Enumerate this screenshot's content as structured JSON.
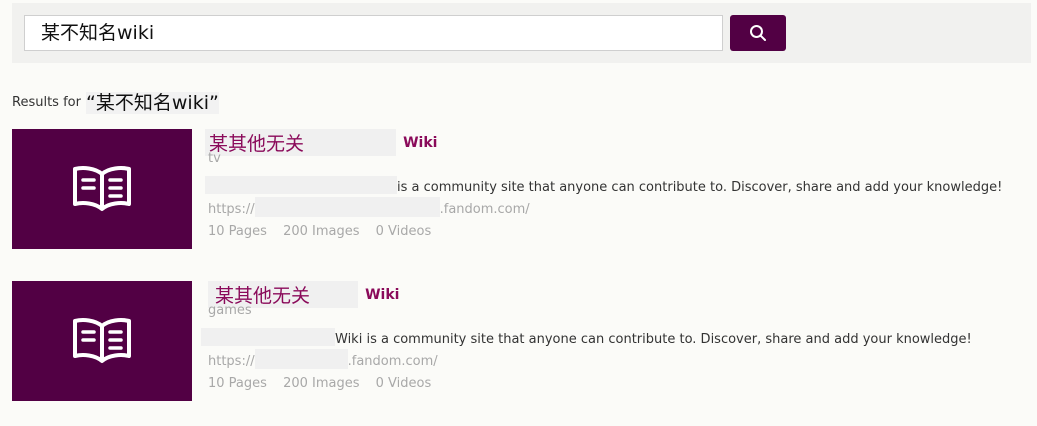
{
  "search": {
    "query": "某不知名wiki",
    "button_icon": "search-icon"
  },
  "results_header": {
    "label": "Results for",
    "query": "“某不知名wiki”"
  },
  "results": [
    {
      "title": "某其他无关",
      "wiki_label": "Wiki",
      "category": "tv",
      "description": "is a community site that anyone can contribute to. Discover, share and add your knowledge!",
      "url_prefix": "https://",
      "url_suffix": ".fandom.com/",
      "pages": "10 Pages",
      "images": "200 Images",
      "videos": "0 Videos",
      "icon": "open-book-icon"
    },
    {
      "title": "某其他无关",
      "wiki_label": "Wiki",
      "category": "games",
      "description": "Wiki is a community site that anyone can contribute to. Discover, share and add your knowledge!",
      "url_prefix": "https://",
      "url_suffix": ".fandom.com/",
      "pages": "10 Pages",
      "images": "200 Images",
      "videos": "0 Videos",
      "icon": "open-book-icon"
    }
  ],
  "colors": {
    "brand": "#520044",
    "title": "#8a0a5a",
    "muted": "#a8a8a8"
  }
}
